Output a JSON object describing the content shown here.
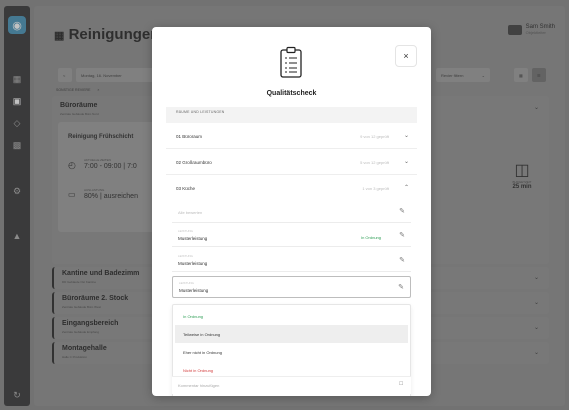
{
  "app": {
    "title": "Reinigungen",
    "title_icon": "calendar-icon",
    "user_name": "Sam Smith",
    "user_role": "Objektleiter"
  },
  "toolbar": {
    "prev": "<",
    "date": "Montag, 16. November",
    "filter": "Revier filtern",
    "filter_chevron": "⌄"
  },
  "background": {
    "section_tag": "SONSTIGE REVIERE",
    "section_tag_close": "×",
    "panel_title": "Büroräume",
    "panel_sub": "Zentrale Gebäude Büro Nord",
    "shift_title": "Reinigung Frühschicht",
    "shift_time_label": "AKTUELLE ZEITEN",
    "shift_time": "7:00 - 09:00 | 7:0",
    "shift_progress_label": "AUSLASTUNG",
    "shift_progress": "80% | ausreichen",
    "tile_value": "25 min",
    "tile_label": "BUDGETZEIT",
    "rows": [
      {
        "title": "Kantine und Badezimm",
        "sub": "DD Gebäude Ost Kantine"
      },
      {
        "title": "Büroräume 2. Stock",
        "sub": "Zentrale Gebäude Büro West"
      },
      {
        "title": "Eingangsbereich",
        "sub": "Zentrale Gebäude Empfang"
      },
      {
        "title": "Montagehalle",
        "sub": "Halle C Produktion"
      }
    ]
  },
  "modal": {
    "title": "Qualitätscheck",
    "close": "×",
    "section_header": "RÄUME UND LEISTUNGEN",
    "rooms": [
      {
        "label": "01 Büroraum",
        "count": "9 von 12 geprüft",
        "chevron": "⌄"
      },
      {
        "label": "02 Großraumbüro",
        "count": "5 von 12 geprüft",
        "chevron": "⌄"
      },
      {
        "label": "03 Küche",
        "count": "1 von 3 geprüft",
        "chevron": "⌃"
      }
    ],
    "subitems": [
      {
        "top": "",
        "label": "",
        "placeholder": "Alle bewerten",
        "status": ""
      },
      {
        "top": "LEISTUNG",
        "label": "Musterleistung",
        "placeholder": "",
        "status": "In Ordnung"
      },
      {
        "top": "LEISTUNG",
        "label": "Musterleistung",
        "placeholder": "",
        "status": ""
      },
      {
        "top": "LEISTUNG",
        "label": "Musterleistung",
        "placeholder": "",
        "status": ""
      }
    ],
    "options": [
      {
        "label": "In Ordnung"
      },
      {
        "label": "Teilweise in Ordnung"
      },
      {
        "label": "Eher nicht in Ordnung"
      },
      {
        "label": "Nicht in Ordnung"
      }
    ],
    "comment_placeholder": "Kommentar hinzufügen"
  },
  "colors": {
    "ok": "#2e9e55",
    "bad": "#d23b3b",
    "logo": "#3f8fb5"
  }
}
